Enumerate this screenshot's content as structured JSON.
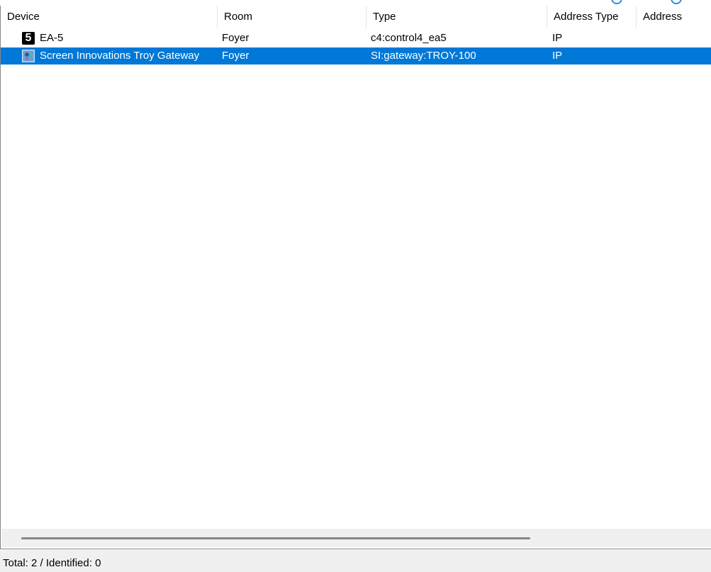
{
  "columns": {
    "device": "Device",
    "room": "Room",
    "type": "Type",
    "address_type": "Address Type",
    "address": "Address"
  },
  "rows": [
    {
      "icon": "control4-ea5-icon",
      "icon_glyph": "5",
      "device": "EA-5",
      "room": "Foyer",
      "type": "c4:control4_ea5",
      "address_type": "IP",
      "address": "",
      "selected": false
    },
    {
      "icon": "screen-innovations-icon",
      "device": "Screen Innovations Troy Gateway",
      "room": "Foyer",
      "type": "SI:gateway:TROY-100",
      "address_type": "IP",
      "address": "",
      "selected": true
    }
  ],
  "status": {
    "text": "Total: 2 / Identified: 0"
  },
  "colors": {
    "selection": "#0078d7",
    "selection_text": "#ffffff",
    "statusbar_bg": "#f0f0f0",
    "accent": "#2a8ce0"
  }
}
